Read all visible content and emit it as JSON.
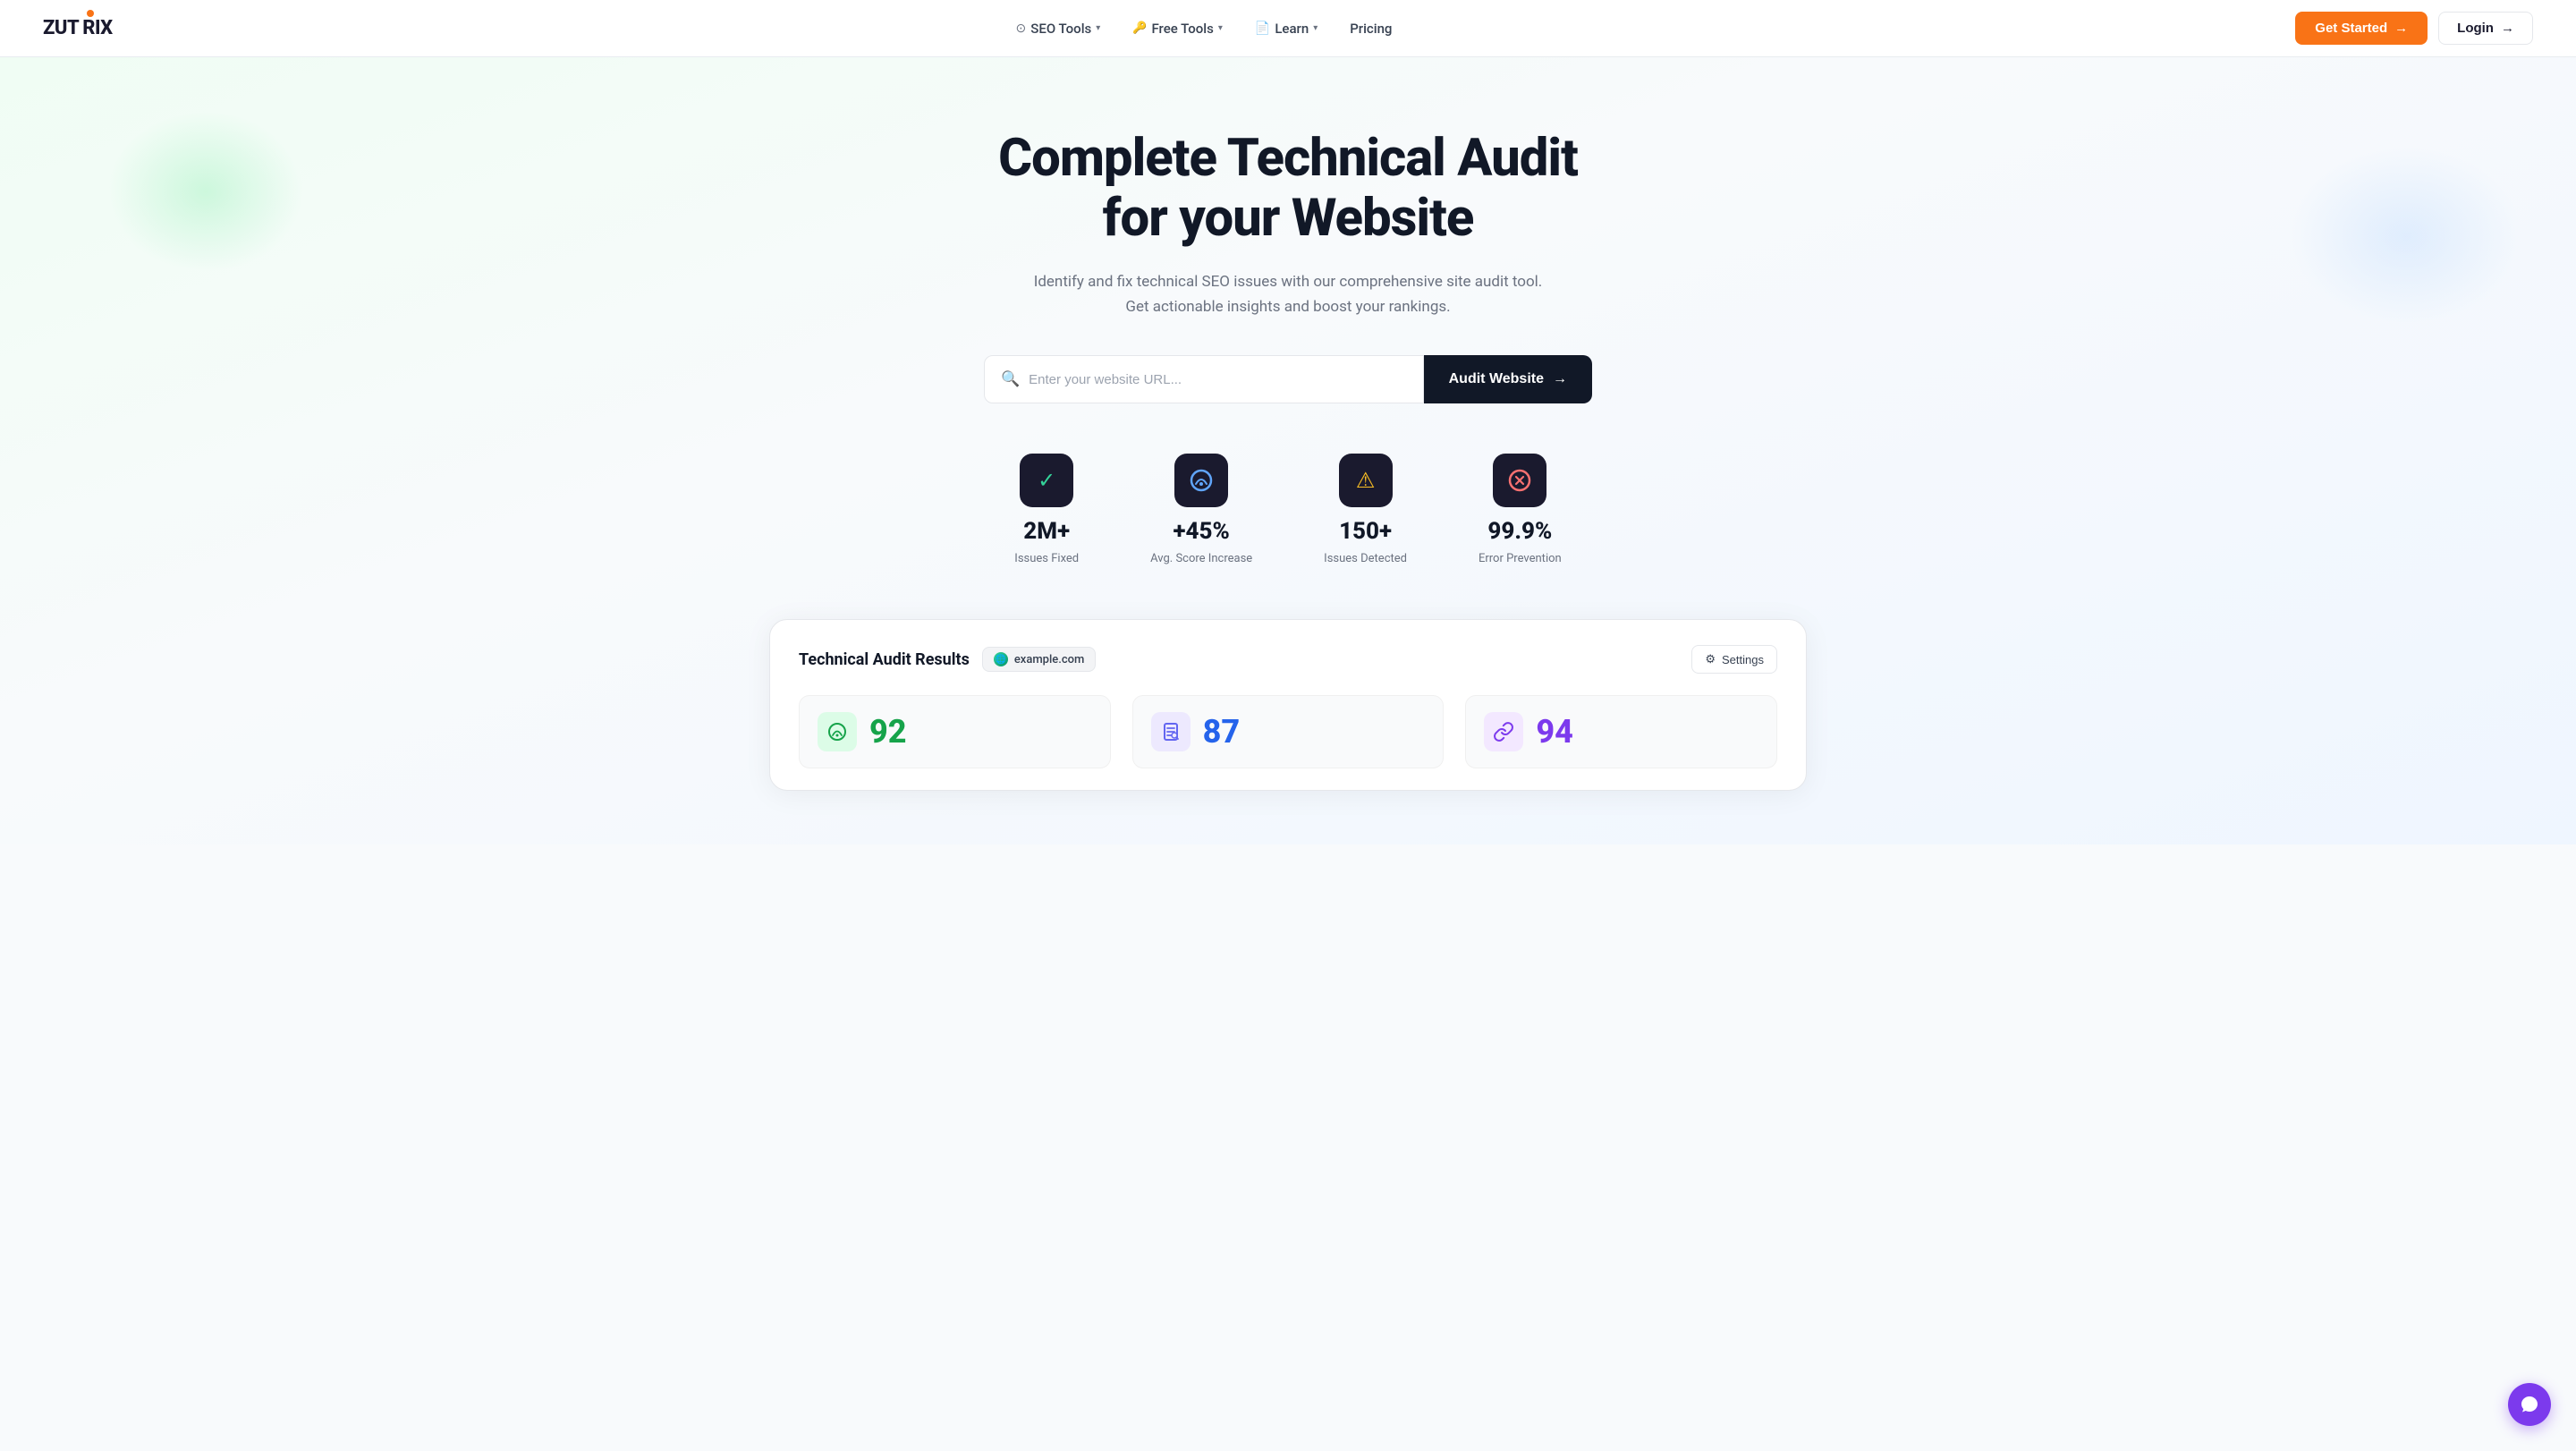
{
  "nav": {
    "logo_text": "ZUTRIX",
    "links": [
      {
        "id": "seo-tools",
        "label": "SEO Tools",
        "has_dropdown": true,
        "icon": "⊙"
      },
      {
        "id": "free-tools",
        "label": "Free Tools",
        "has_dropdown": true,
        "icon": "🔑"
      },
      {
        "id": "learn",
        "label": "Learn",
        "has_dropdown": true,
        "icon": "📄"
      },
      {
        "id": "pricing",
        "label": "Pricing",
        "has_dropdown": false,
        "icon": ""
      }
    ],
    "cta_label": "Get Started",
    "login_label": "Login"
  },
  "hero": {
    "title_line1": "Complete Technical Audit",
    "title_line2": "for your Website",
    "subtitle": "Identify and fix technical SEO issues with our comprehensive site audit tool. Get actionable insights and boost your rankings.",
    "search_placeholder": "Enter your website URL...",
    "audit_button_label": "Audit Website"
  },
  "stats": [
    {
      "id": "issues-fixed",
      "icon": "✓",
      "icon_color": "#34d399",
      "value": "2M+",
      "label": "Issues Fixed"
    },
    {
      "id": "score-increase",
      "icon": "⏱",
      "icon_color": "#60a5fa",
      "value": "+45%",
      "label": "Avg. Score Increase"
    },
    {
      "id": "issues-detected",
      "icon": "⚠",
      "icon_color": "#fbbf24",
      "value": "150+",
      "label": "Issues Detected"
    },
    {
      "id": "error-prevention",
      "icon": "⊗",
      "icon_color": "#f87171",
      "value": "99.9%",
      "label": "Error Prevention"
    }
  ],
  "results_card": {
    "title": "Technical Audit Results",
    "domain": "example.com",
    "settings_label": "Settings",
    "metrics": [
      {
        "id": "performance",
        "icon": "⏱",
        "icon_bg": "green",
        "value": "92",
        "value_color": "green"
      },
      {
        "id": "seo",
        "icon": "📋",
        "icon_bg": "blue-purple",
        "value": "87",
        "value_color": "blue"
      },
      {
        "id": "links",
        "icon": "🔗",
        "icon_bg": "purple",
        "value": "94",
        "value_color": "purple"
      }
    ]
  },
  "chat": {
    "icon": "💬"
  }
}
